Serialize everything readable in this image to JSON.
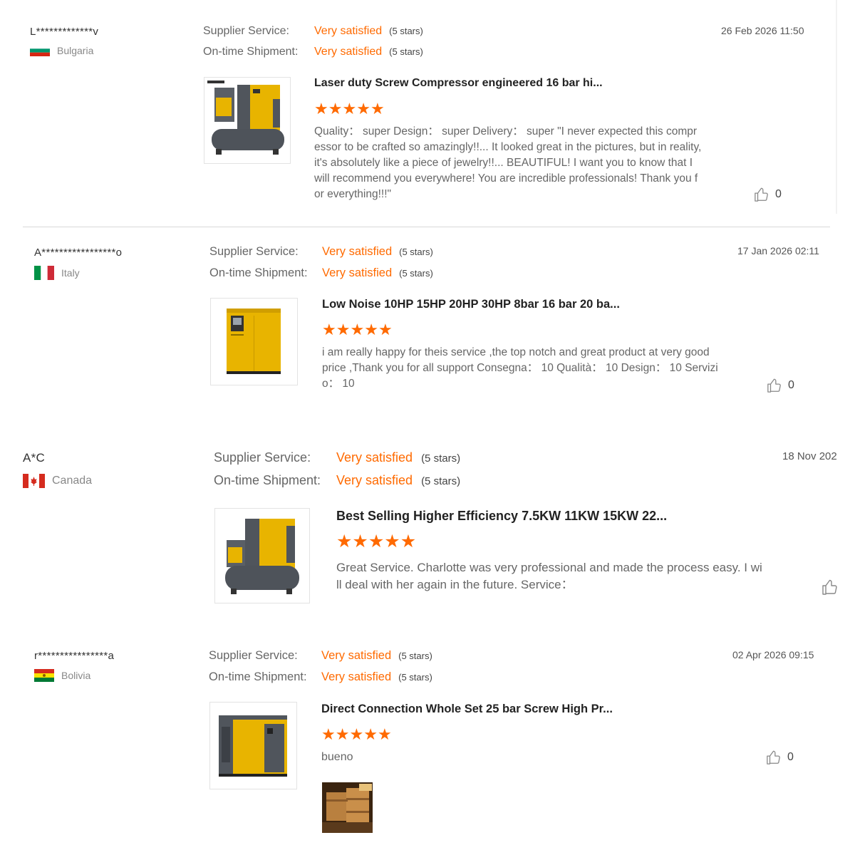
{
  "colors": {
    "accent": "#ff6a00"
  },
  "reviews": [
    {
      "buyer": "L*************v",
      "country": "Bulgaria",
      "flag": "bulgaria-flag",
      "supplier_service_label": "Supplier Service:",
      "supplier_service_value": "Very satisfied",
      "supplier_service_stars": "(5 stars)",
      "shipment_label": "On-time Shipment:",
      "shipment_value": "Very satisfied",
      "shipment_stars": "(5 stars)",
      "date": "26 Feb 2026 11:50",
      "product_title": "Laser duty Screw Compressor engineered 16 bar hi...",
      "rating": 5,
      "comment": "Quality： super Design： super Delivery： super \"I never expected this compressor to be crafted so amazingly!!... It looked great in the pictures, but in reality, it's absolutely like a piece of jewelry!!... BEAUTIFUL! I want you to know that I will recommend you everywhere! You are incredible professionals! Thank you for everything!!!\"",
      "likes": "0",
      "thumb_icon": "screw-compressor-with-tank-icon"
    },
    {
      "buyer": "A*****************o",
      "country": "Italy",
      "flag": "italy-flag",
      "supplier_service_label": "Supplier Service:",
      "supplier_service_value": "Very satisfied",
      "supplier_service_stars": "(5 stars)",
      "shipment_label": "On-time Shipment:",
      "shipment_value": "Very satisfied",
      "shipment_stars": "(5 stars)",
      "date": "17 Jan 2026 02:11",
      "product_title": "Low Noise 10HP 15HP 20HP 30HP 8bar 16 bar 20 ba...",
      "rating": 5,
      "comment": "i am really happy for theis service ,the top notch and great product at very good price ,Thank you for all support Consegna： 10 Qualità： 10 Design： 10 Servizio： 10",
      "likes": "0",
      "thumb_icon": "cabinet-compressor-icon"
    },
    {
      "buyer": "A*C",
      "country": "Canada",
      "flag": "canada-flag",
      "supplier_service_label": "Supplier Service:",
      "supplier_service_value": "Very satisfied",
      "supplier_service_stars": "(5 stars)",
      "shipment_label": "On-time Shipment:",
      "shipment_value": "Very satisfied",
      "shipment_stars": "(5 stars)",
      "date": "18 Nov 202",
      "product_title": "Best Selling Higher Efficiency 7.5KW 11KW 15KW 22...",
      "rating": 5,
      "comment": "Great Service. Charlotte was very professional and made the process easy. I will deal with her again in the future. Service：",
      "likes": "",
      "thumb_icon": "screw-compressor-with-tank-icon"
    },
    {
      "buyer": "r****************a",
      "country": "Bolivia",
      "flag": "bolivia-flag",
      "supplier_service_label": "Supplier Service:",
      "supplier_service_value": "Very satisfied",
      "supplier_service_stars": "(5 stars)",
      "shipment_label": "On-time Shipment:",
      "shipment_value": "Very satisfied",
      "shipment_stars": "(5 stars)",
      "date": "02 Apr 2026 09:15",
      "product_title": "Direct Connection Whole Set 25 bar Screw High Pr...",
      "rating": 5,
      "comment": "bueno",
      "likes": "0",
      "thumb_icon": "direct-connection-compressor-icon",
      "attachment_icon": "wooden-crate-photo-icon"
    }
  ]
}
